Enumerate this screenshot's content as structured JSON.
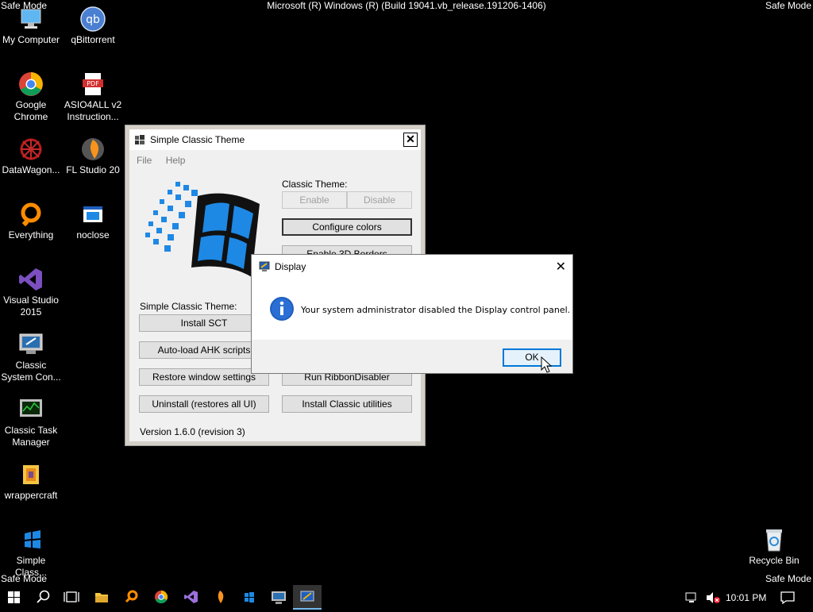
{
  "desktop": {
    "watermark": "Safe Mode",
    "build_text": "Microsoft (R) Windows (R) (Build 19041.vb_release.191206-1406)",
    "icons": [
      {
        "label": "My Computer",
        "icon": "computer-icon"
      },
      {
        "label": "qBittorrent",
        "icon": "qbittorrent-icon"
      },
      {
        "label": "Google\nChrome",
        "icon": "chrome-icon"
      },
      {
        "label": "ASIO4ALL v2\nInstruction...",
        "icon": "pdf-icon"
      },
      {
        "label": "DataWagon...",
        "icon": "datawagon-icon"
      },
      {
        "label": "FL Studio 20",
        "icon": "fl-studio-icon"
      },
      {
        "label": "Everything",
        "icon": "everything-icon"
      },
      {
        "label": "noclose",
        "icon": "window-icon"
      },
      {
        "label": "Visual Studio\n2015",
        "icon": "visual-studio-icon"
      },
      {
        "label": "Classic\nSystem Con...",
        "icon": "control-panel-icon"
      },
      {
        "label": "Classic Task\nManager",
        "icon": "task-manager-icon"
      },
      {
        "label": "wrappercraft",
        "icon": "wrappercraft-icon"
      },
      {
        "label": "Simple\nClass...",
        "icon": "simple-classic-icon"
      },
      {
        "label": "Recycle Bin",
        "icon": "recycle-bin-icon"
      }
    ]
  },
  "sct_window": {
    "title": "Simple Classic Theme",
    "menu": [
      "File",
      "Help"
    ],
    "classic_theme_label": "Classic Theme:",
    "enable": "Enable",
    "disable": "Disable",
    "configure_colors": "Configure colors",
    "enable_3d_borders": "Enable 3D Borders",
    "sct_label": "Simple Classic Theme:",
    "install_sct": "Install SCT",
    "autoload_ahk": "Auto-load AHK scripts",
    "restore_window": "Restore window settings",
    "run_ribbon": "Run RibbonDisabler",
    "uninstall": "Uninstall (restores all UI)",
    "install_classic": "Install Classic utilities",
    "version": "Version 1.6.0 (revision 3)"
  },
  "display_dialog": {
    "title": "Display",
    "message": "Your system administrator disabled the Display control panel.",
    "ok_label": "OK"
  },
  "taskbar": {
    "time": "10:01 PM",
    "accent": "#76b9ed"
  }
}
